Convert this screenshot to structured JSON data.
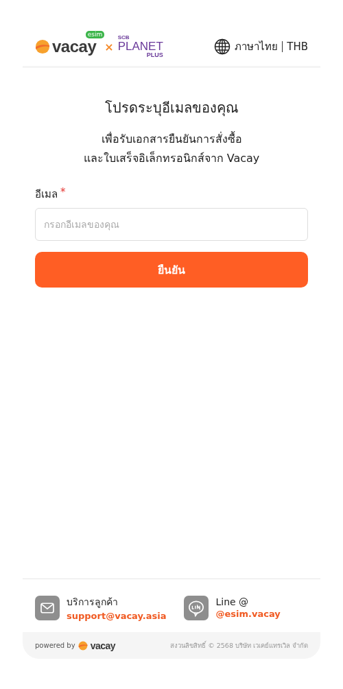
{
  "header": {
    "brand": {
      "name": "vacay",
      "badge": "esim",
      "separator": "×",
      "partner_top": "SCB",
      "partner_main": "PLANET",
      "partner_sub": "PLUS"
    },
    "language": "ภาษาไทย",
    "currency": "THB"
  },
  "form": {
    "title": "โปรดระบุอีเมลของคุณ",
    "subtitle_lines": [
      "เพื่อรับเอกสารยืนยันการสั่งซื้อ",
      "และใบเสร็จอิเล็กทรอนิกส์จาก Vacay"
    ],
    "field_label": "อีเมล",
    "required_mark": "*",
    "placeholder": "กรอกอีเมลของคุณ",
    "submit": "ยืนยัน"
  },
  "contacts": [
    {
      "kind": "mail",
      "label": "บริการลูกค้า",
      "value": "support@vacay.asia"
    },
    {
      "kind": "line",
      "label": "Line @",
      "value": "@esim.vacay"
    }
  ],
  "footer": {
    "powered_by": "powered by",
    "brand": "vacay",
    "copyright": "สงวนลิขสิทธิ์ © 2568 บริษัท เวเคย์แทรเวิล จำกัด"
  }
}
